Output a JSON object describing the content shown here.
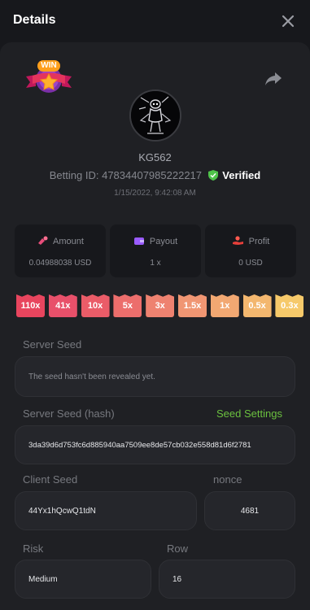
{
  "header": {
    "title": "Details",
    "close_icon": "close-icon"
  },
  "badge": {
    "text": "WIN",
    "icon": "star-icon"
  },
  "share_icon": "share-icon",
  "player": {
    "username": "KG562",
    "betting_id_label": "Betting ID:",
    "betting_id": "47834407985222217",
    "verified_label": "Verified",
    "date": "1/15/2022, 9:42:08 AM"
  },
  "stats": {
    "amount": {
      "label": "Amount",
      "value": "0.04988038 USD",
      "icon": "coins-icon"
    },
    "payout": {
      "label": "Payout",
      "value": "1 x",
      "icon": "wallet-icon"
    },
    "profit": {
      "label": "Profit",
      "value": "0 USD",
      "icon": "hand-coins-icon"
    }
  },
  "multipliers": [
    "110x",
    "41x",
    "10x",
    "5x",
    "3x",
    "1.5x",
    "1x",
    "0.5x",
    "0.3x"
  ],
  "multiplier_colors": [
    "#e8455e",
    "#e8506a",
    "#ea5c68",
    "#ec6e6c",
    "#ee8270",
    "#f09673",
    "#f2a872",
    "#f3b76f",
    "#f6c96a"
  ],
  "server_seed": {
    "label": "Server Seed",
    "value": "The seed hasn't been revealed yet."
  },
  "server_seed_hash": {
    "label": "Server Seed (hash)",
    "link": "Seed Settings",
    "value": "3da39d6d753fc6d885940aa7509ee8de57cb032e558d81d6f2781"
  },
  "client_seed": {
    "label": "Client Seed",
    "value": "44Yx1hQcwQ1tdN"
  },
  "nonce": {
    "label": "nonce",
    "value": "4681"
  },
  "risk": {
    "label": "Risk",
    "value": "Medium"
  },
  "row": {
    "label": "Row",
    "value": "16"
  },
  "colors": {
    "accent_green": "#6bc13f",
    "background": "#17181c",
    "panel": "#1f2024"
  }
}
